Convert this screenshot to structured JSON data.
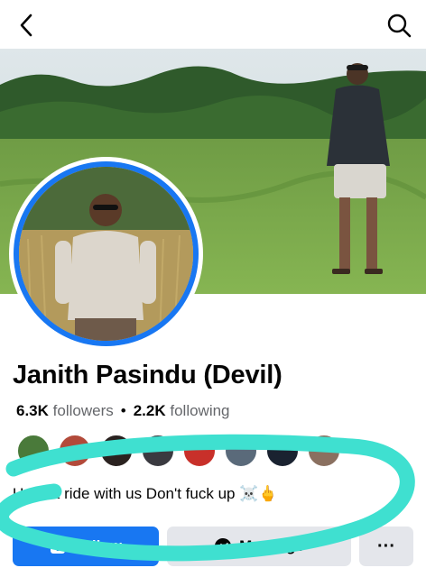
{
  "header": {
    "back_icon": "chevron-left-icon",
    "search_icon": "search-icon"
  },
  "profile": {
    "name": "Janith Pasindu (Devil)",
    "followers_count": "6.3K",
    "followers_label": "followers",
    "following_count": "2.2K",
    "following_label": "following",
    "bio": "U can't ride with us Don't fuck up ☠️🖕"
  },
  "actions": {
    "follow_label": "Follow",
    "message_label": "Message",
    "more_label": "···"
  },
  "colors": {
    "accent": "#1877f2",
    "secondary_button": "#e4e6eb",
    "scribble": "#3fe0d0"
  }
}
